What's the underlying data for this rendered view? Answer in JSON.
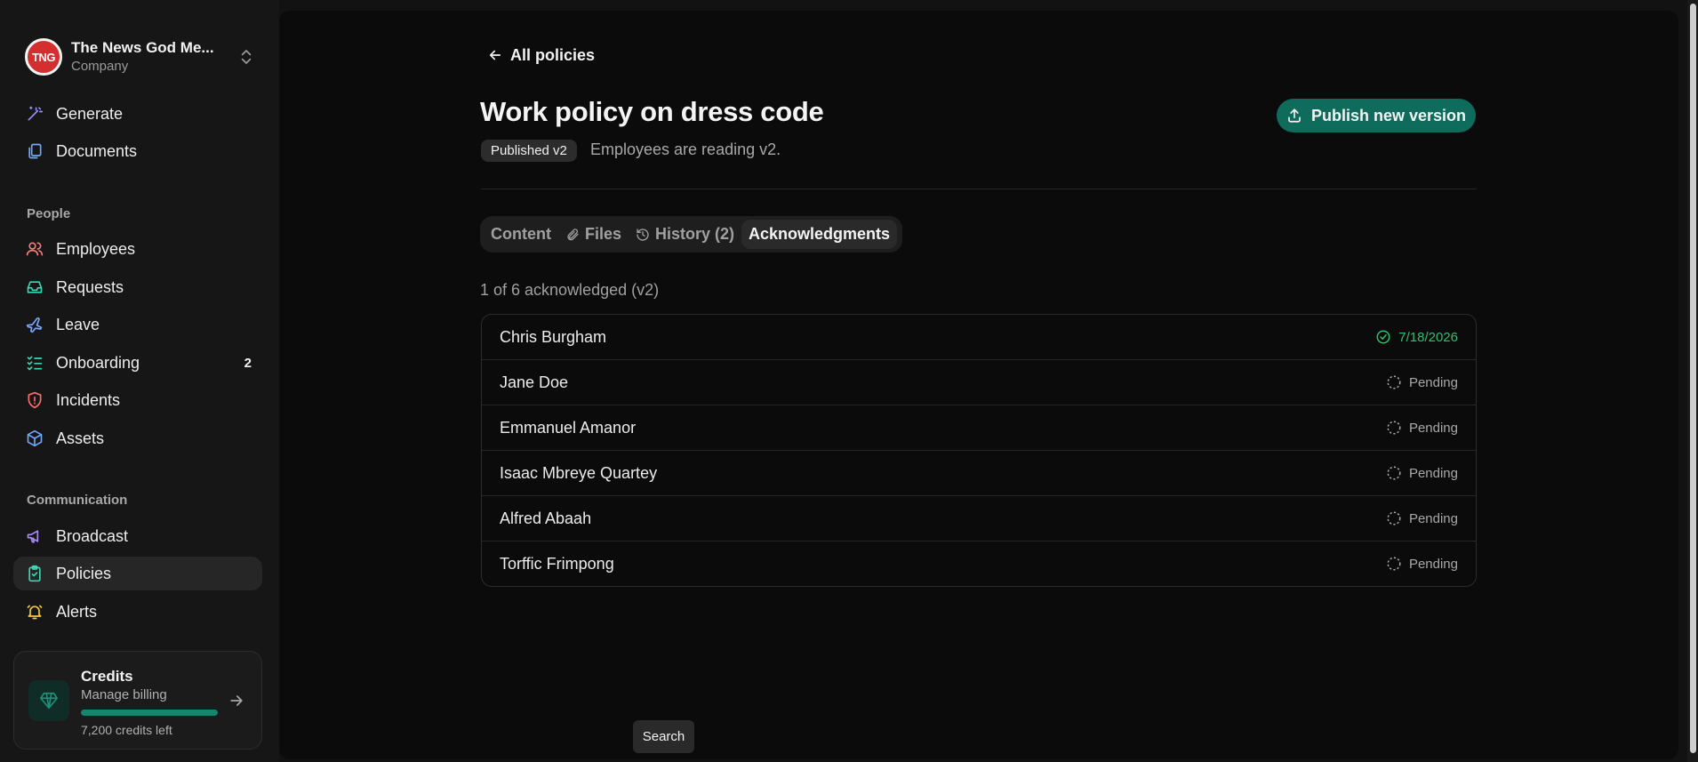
{
  "org": {
    "logo_text": "TNG",
    "name": "The News God Me...",
    "type": "Company"
  },
  "nav": {
    "generate": "Generate",
    "documents": "Documents",
    "people_label": "People",
    "employees": "Employees",
    "requests": "Requests",
    "leave": "Leave",
    "onboarding": "Onboarding",
    "onboarding_badge": "2",
    "incidents": "Incidents",
    "assets": "Assets",
    "communication_label": "Communication",
    "broadcast": "Broadcast",
    "policies": "Policies",
    "alerts": "Alerts"
  },
  "credits": {
    "title": "Credits",
    "subtitle": "Manage billing",
    "remaining_label": "7,200 credits left",
    "progress_fraction": 1.0
  },
  "page": {
    "back_label": "All policies",
    "title": "Work policy on dress code",
    "version_badge": "Published v2",
    "subtitle": "Employees are reading v2.",
    "publish_label": "Publish new version"
  },
  "tabs": {
    "content": "Content",
    "files": "Files",
    "history": "History (2)",
    "acknowledgments": "Acknowledgments"
  },
  "ack": {
    "summary": "1 of 6 acknowledged (v2)",
    "rows": [
      {
        "name": "Chris Burgham",
        "status": "7/18/2026"
      },
      {
        "name": "Jane Doe",
        "status": "Pending"
      },
      {
        "name": "Emmanuel Amanor",
        "status": "Pending"
      },
      {
        "name": "Isaac Mbreye Quartey",
        "status": "Pending"
      },
      {
        "name": "Alfred Abaah",
        "status": "Pending"
      },
      {
        "name": "Torffic Frimpong",
        "status": "Pending"
      }
    ]
  },
  "tooltip": {
    "search": "Search"
  },
  "colors": {
    "accent": "#0f6b5b",
    "success": "#2fbf71",
    "brand_red": "#d32f2f"
  }
}
